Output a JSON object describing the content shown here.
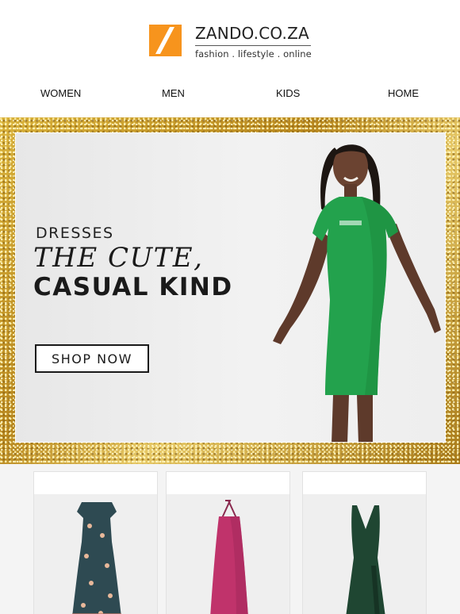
{
  "brand": {
    "name": "ZANDO.CO.ZA",
    "tagline": "fashion . lifestyle . online",
    "accent": "#f7941d"
  },
  "nav": {
    "items": [
      {
        "label": "WOMEN"
      },
      {
        "label": "MEN"
      },
      {
        "label": "KIDS"
      },
      {
        "label": "HOME"
      }
    ]
  },
  "hero": {
    "eyebrow": "DRESSES",
    "title": "THE CUTE,",
    "subtitle": "CASUAL KIND",
    "cta_label": "SHOP NOW",
    "frame_color": "#c9a233",
    "dress_color": "#23a24d"
  },
  "products": [
    {
      "name": "floral-maxi-dress",
      "color": "#2e4a52"
    },
    {
      "name": "pink-halter-dress",
      "color": "#c0336b"
    },
    {
      "name": "green-v-neck-maxi-dress",
      "color": "#1f4632"
    }
  ]
}
